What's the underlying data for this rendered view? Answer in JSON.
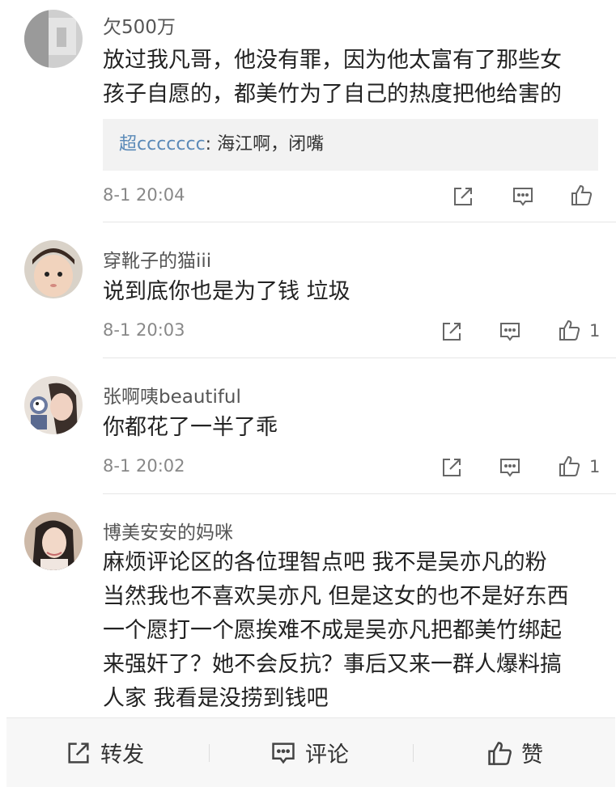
{
  "comments": [
    {
      "username": "欠500万",
      "lines": [
        "放过我凡哥，他没有罪，因为他太富有了那些女",
        "孩子自愿的，都美竹为了自己的热度把他给害的"
      ],
      "reply": {
        "name": "超ccccccc",
        "sep": ":",
        "text": " 海江啊，闭嘴"
      },
      "timestamp": "8-1 20:04",
      "like_count": ""
    },
    {
      "username": "穿靴子的猫iii",
      "lines": [
        "说到底你也是为了钱 垃圾"
      ],
      "timestamp": "8-1 20:03",
      "like_count": "1"
    },
    {
      "username": "张啊咦beautiful",
      "lines": [
        "你都花了一半了乖"
      ],
      "timestamp": "8-1 20:02",
      "like_count": "1"
    },
    {
      "username": "博美安安的妈咪",
      "lines": [
        "麻烦评论区的各位理智点吧 我不是吴亦凡的粉",
        "当然我也不喜欢吴亦凡 但是这女的也不是好东西",
        "一个愿打一个愿挨难不成是吴亦凡把都美竹绑起",
        "来强奸了？她不会反抗？事后又来一群人爆料搞",
        "人家 我看是没捞到钱吧"
      ]
    }
  ],
  "bottom_bar": {
    "repost_label": "转发",
    "comment_label": "评论",
    "like_label": "赞"
  },
  "icons": {
    "share": "share-icon",
    "comment": "comment-icon",
    "like": "thumbs-up-icon"
  },
  "colors": {
    "reply_name": "#5b8ab8",
    "reply_bg": "#f2f2f2",
    "text": "#222222",
    "meta": "#888888"
  }
}
